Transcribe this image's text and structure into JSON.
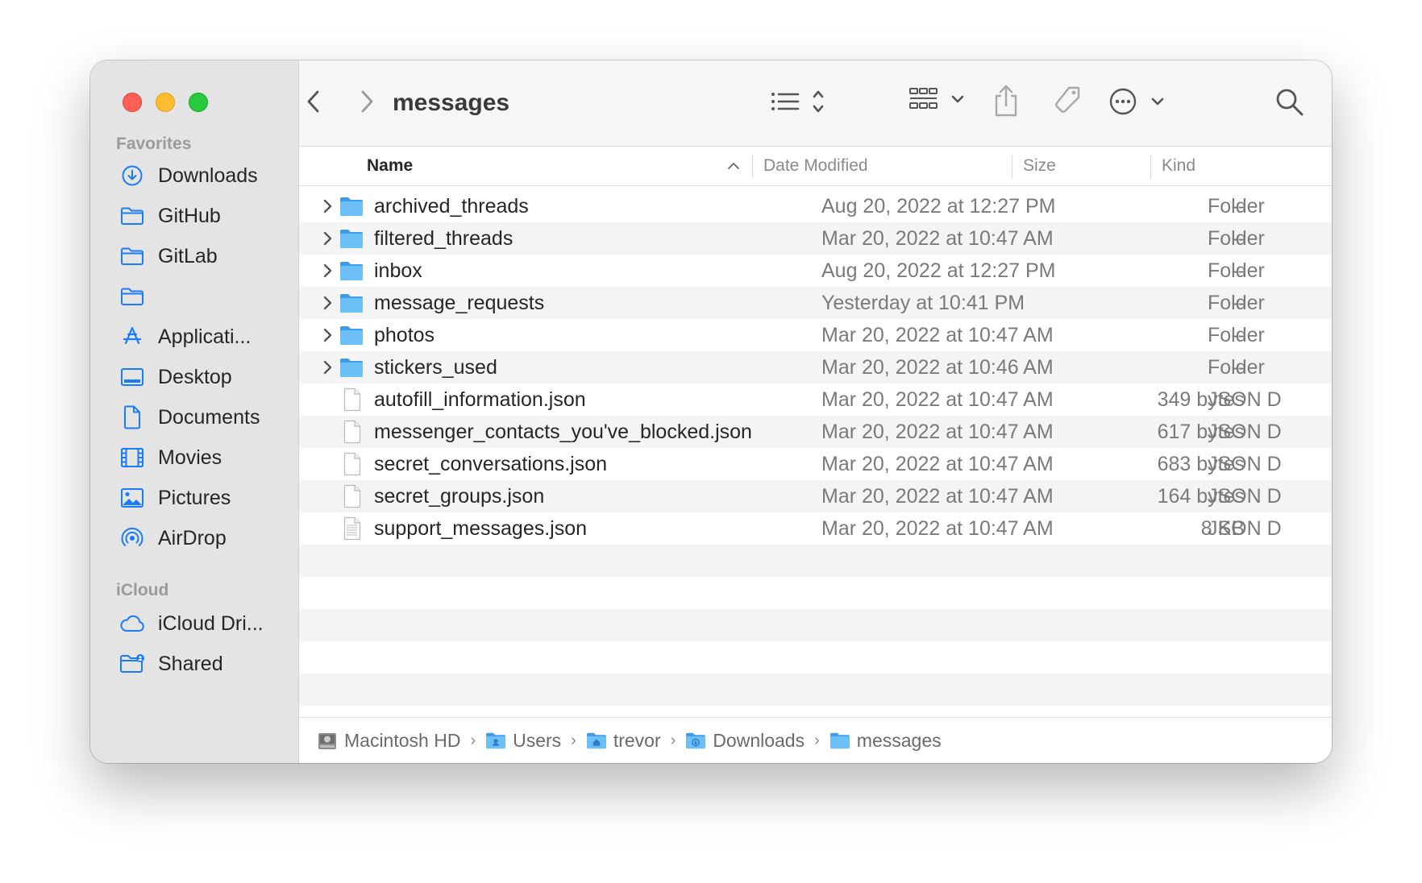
{
  "window": {
    "title": "messages"
  },
  "sidebar": {
    "sections": [
      {
        "label": "Favorites"
      },
      {
        "label": "iCloud"
      }
    ],
    "items": [
      {
        "label": "Downloads",
        "icon": "download-circle-icon"
      },
      {
        "label": "GitHub",
        "icon": "folder-icon"
      },
      {
        "label": "GitLab",
        "icon": "folder-icon"
      },
      {
        "label": "",
        "icon": "folder-icon"
      },
      {
        "label": "Applicati...",
        "icon": "applications-icon"
      },
      {
        "label": "Desktop",
        "icon": "desktop-icon"
      },
      {
        "label": "Documents",
        "icon": "document-icon"
      },
      {
        "label": "Movies",
        "icon": "film-icon"
      },
      {
        "label": "Pictures",
        "icon": "photo-icon"
      },
      {
        "label": "AirDrop",
        "icon": "airdrop-icon"
      },
      {
        "label": "iCloud Dri...",
        "icon": "cloud-icon"
      },
      {
        "label": "Shared",
        "icon": "shared-folder-icon"
      }
    ]
  },
  "columns": {
    "name": "Name",
    "date": "Date Modified",
    "size": "Size",
    "kind": "Kind"
  },
  "files": [
    {
      "name": "archived_threads",
      "date": "Aug 20, 2022 at 12:27 PM",
      "size": "--",
      "kind": "Folder",
      "type": "folder"
    },
    {
      "name": "filtered_threads",
      "date": "Mar 20, 2022 at 10:47 AM",
      "size": "--",
      "kind": "Folder",
      "type": "folder"
    },
    {
      "name": "inbox",
      "date": "Aug 20, 2022 at 12:27 PM",
      "size": "--",
      "kind": "Folder",
      "type": "folder"
    },
    {
      "name": "message_requests",
      "date": "Yesterday at 10:41 PM",
      "size": "--",
      "kind": "Folder",
      "type": "folder"
    },
    {
      "name": "photos",
      "date": "Mar 20, 2022 at 10:47 AM",
      "size": "--",
      "kind": "Folder",
      "type": "folder"
    },
    {
      "name": "stickers_used",
      "date": "Mar 20, 2022 at 10:46 AM",
      "size": "--",
      "kind": "Folder",
      "type": "folder"
    },
    {
      "name": "autofill_information.json",
      "date": "Mar 20, 2022 at 10:47 AM",
      "size": "349 bytes",
      "kind": "JSON D",
      "type": "file"
    },
    {
      "name": "messenger_contacts_you've_blocked.json",
      "date": "Mar 20, 2022 at 10:47 AM",
      "size": "617 bytes",
      "kind": "JSON D",
      "type": "file"
    },
    {
      "name": "secret_conversations.json",
      "date": "Mar 20, 2022 at 10:47 AM",
      "size": "683 bytes",
      "kind": "JSON D",
      "type": "file"
    },
    {
      "name": "secret_groups.json",
      "date": "Mar 20, 2022 at 10:47 AM",
      "size": "164 bytes",
      "kind": "JSON D",
      "type": "file"
    },
    {
      "name": "support_messages.json",
      "date": "Mar 20, 2022 at 10:47 AM",
      "size": "8 KB",
      "kind": "JSON D",
      "type": "file-lined"
    }
  ],
  "pathbar": [
    {
      "label": "Macintosh HD",
      "icon": "hard-drive-icon"
    },
    {
      "label": "Users",
      "icon": "users-folder-icon"
    },
    {
      "label": "trevor",
      "icon": "home-folder-icon"
    },
    {
      "label": "Downloads",
      "icon": "downloads-folder-icon"
    },
    {
      "label": "messages",
      "icon": "folder-icon"
    }
  ],
  "colors": {
    "accent": "#1a7cf5",
    "folder_blue": "#5fb6f5",
    "sidebar_bg": "#e4e4e4",
    "row_alt": "#f4f4f4"
  }
}
